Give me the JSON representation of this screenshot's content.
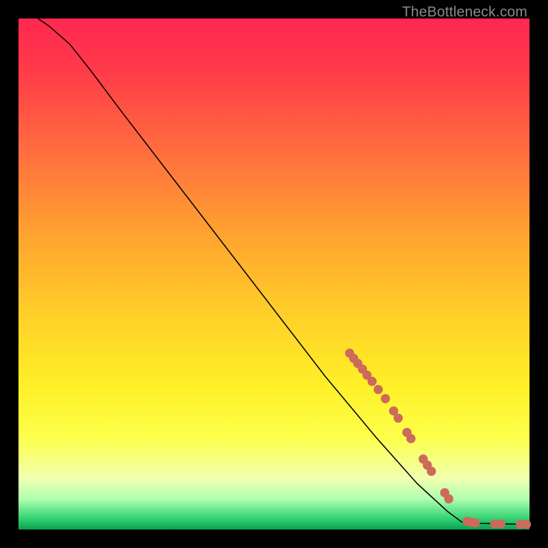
{
  "watermark": "TheBottleneck.com",
  "chart_data": {
    "type": "line",
    "title": "",
    "xlabel": "",
    "ylabel": "",
    "xlim": [
      0,
      100
    ],
    "ylim": [
      0,
      100
    ],
    "curve": [
      {
        "x": 3.8,
        "y": 100.0
      },
      {
        "x": 6.0,
        "y": 98.5
      },
      {
        "x": 10.0,
        "y": 95.0
      },
      {
        "x": 14.0,
        "y": 90.0
      },
      {
        "x": 20.0,
        "y": 82.0
      },
      {
        "x": 30.0,
        "y": 69.0
      },
      {
        "x": 40.0,
        "y": 56.0
      },
      {
        "x": 50.0,
        "y": 43.0
      },
      {
        "x": 60.0,
        "y": 30.0
      },
      {
        "x": 70.0,
        "y": 18.0
      },
      {
        "x": 78.0,
        "y": 9.0
      },
      {
        "x": 84.0,
        "y": 3.5
      },
      {
        "x": 86.7,
        "y": 1.5
      },
      {
        "x": 90.0,
        "y": 1.2
      },
      {
        "x": 95.0,
        "y": 1.1
      },
      {
        "x": 100.0,
        "y": 1.0
      }
    ],
    "dots": [
      {
        "x": 64.8,
        "y": 34.5
      },
      {
        "x": 65.6,
        "y": 33.5
      },
      {
        "x": 66.4,
        "y": 32.5
      },
      {
        "x": 67.3,
        "y": 31.4
      },
      {
        "x": 68.2,
        "y": 30.2
      },
      {
        "x": 69.2,
        "y": 29.0
      },
      {
        "x": 70.4,
        "y": 27.4
      },
      {
        "x": 71.8,
        "y": 25.6
      },
      {
        "x": 73.4,
        "y": 23.2
      },
      {
        "x": 74.3,
        "y": 21.8
      },
      {
        "x": 76.0,
        "y": 19.0
      },
      {
        "x": 76.8,
        "y": 17.8
      },
      {
        "x": 79.2,
        "y": 13.8
      },
      {
        "x": 80.0,
        "y": 12.6
      },
      {
        "x": 80.8,
        "y": 11.4
      },
      {
        "x": 83.4,
        "y": 7.2
      },
      {
        "x": 84.2,
        "y": 6.0
      },
      {
        "x": 87.8,
        "y": 1.6
      },
      {
        "x": 88.6,
        "y": 1.4
      },
      {
        "x": 89.4,
        "y": 1.3
      },
      {
        "x": 93.2,
        "y": 1.1
      },
      {
        "x": 94.4,
        "y": 1.1
      },
      {
        "x": 98.2,
        "y": 1.0
      },
      {
        "x": 99.4,
        "y": 1.0
      }
    ],
    "dot_color": "#cc6a5c",
    "dot_radius_px": 6.2
  }
}
